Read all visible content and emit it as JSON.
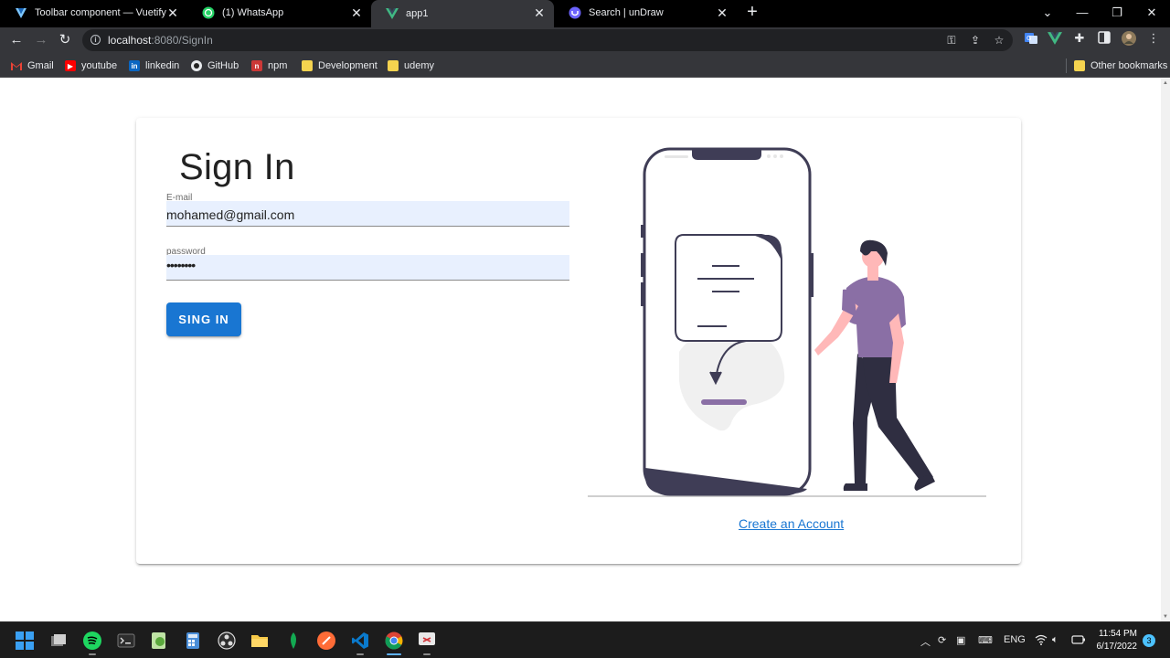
{
  "browser": {
    "tabs": [
      {
        "title": "Toolbar component — Vuetify",
        "icon": "vuetify-icon",
        "active": false
      },
      {
        "title": "(1) WhatsApp",
        "icon": "whatsapp-icon",
        "active": false
      },
      {
        "title": "app1",
        "icon": "vue-icon",
        "active": true
      },
      {
        "title": "Search | unDraw",
        "icon": "undraw-icon",
        "active": false
      }
    ],
    "close_glyph": "✕",
    "new_tab_glyph": "+",
    "url_host": "localhost",
    "url_path": ":8080/SignIn",
    "bookmarks": [
      {
        "label": "Gmail",
        "icon": "gmail-icon"
      },
      {
        "label": "youtube",
        "icon": "youtube-icon"
      },
      {
        "label": "linkedin",
        "icon": "linkedin-icon"
      },
      {
        "label": "GitHub",
        "icon": "github-icon"
      },
      {
        "label": "npm",
        "icon": "npm-icon"
      },
      {
        "label": "Development",
        "icon": "folder-icon"
      },
      {
        "label": "udemy",
        "icon": "folder-icon"
      },
      {
        "label": "Other bookmarks",
        "icon": "folder-icon"
      }
    ]
  },
  "signin": {
    "title": "Sign In",
    "email_label": "E-mail",
    "email_value": "mohamed@gmail.com",
    "password_label": "password",
    "password_value": "••••••••",
    "submit_label": "SING IN",
    "create_account_label": "Create an Account"
  },
  "taskbar": {
    "language": "ENG",
    "time": "11:54 PM",
    "date": "6/17/2022",
    "notifications": "3"
  },
  "colors": {
    "primary": "#1976d2",
    "autofill": "#e8f0fe",
    "illustration_accent": "#8a6fa5",
    "illustration_dark": "#3f3d56"
  }
}
